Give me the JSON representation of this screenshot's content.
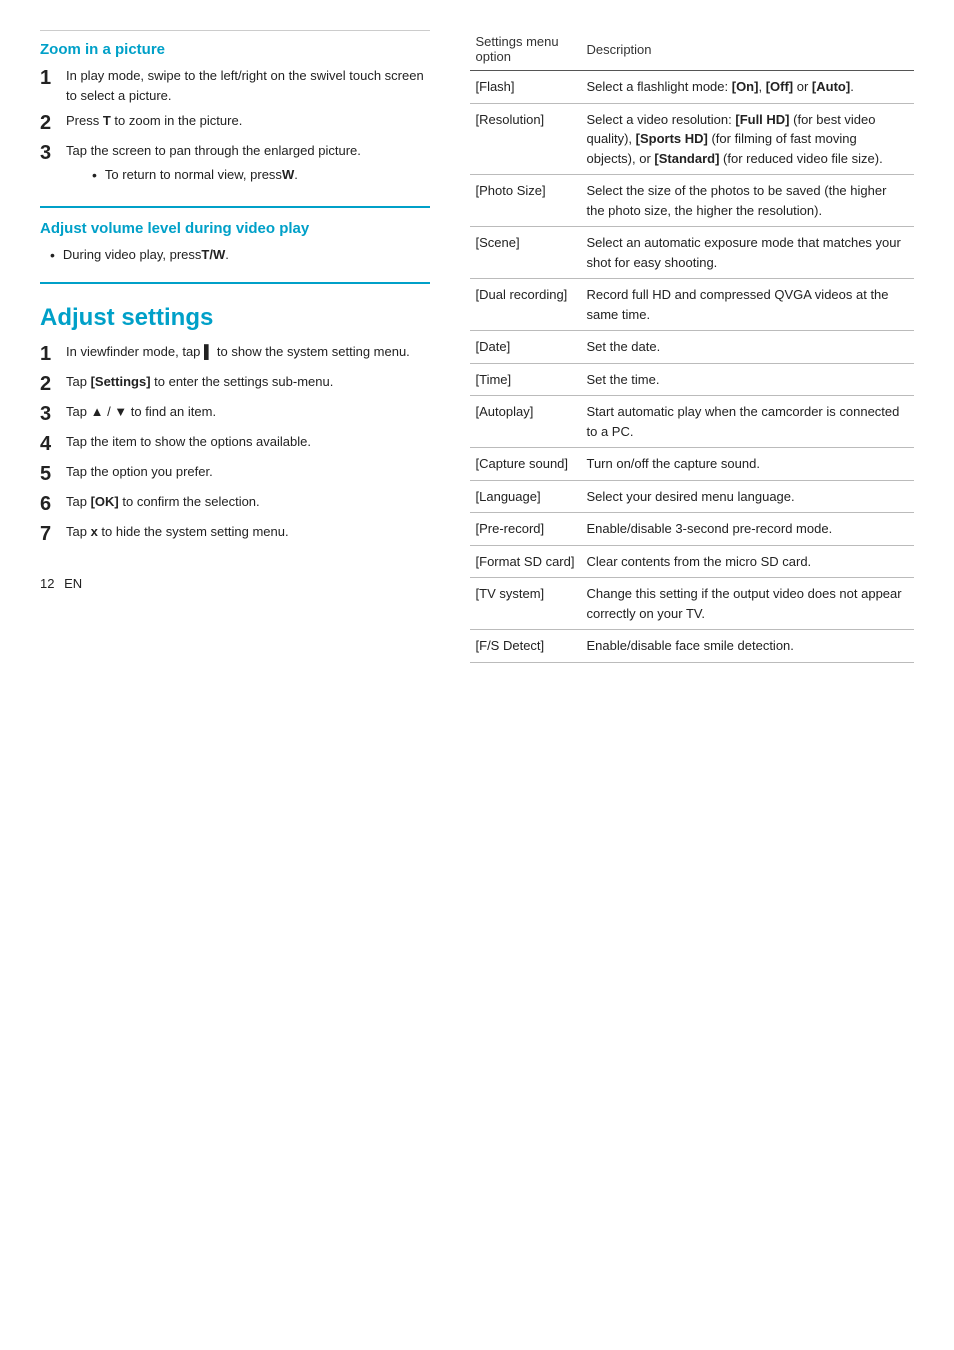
{
  "left": {
    "zoom_section": {
      "title": "Zoom in a picture",
      "steps": [
        {
          "num": "1",
          "text": "In play mode, swipe to the left/right on the swivel touch screen to select a picture."
        },
        {
          "num": "2",
          "text": "Press T to zoom in the picture.",
          "bold_chars": [
            "T"
          ]
        },
        {
          "num": "3",
          "text": "Tap the screen to pan through the enlarged picture.",
          "sub_bullet": "To return to normal view, press W.",
          "sub_bold": [
            "W"
          ]
        }
      ]
    },
    "volume_section": {
      "title": "Adjust volume level during video play",
      "bullet": "During video play, press T/W.",
      "bold_chars": [
        "T/W"
      ]
    },
    "adjust_section": {
      "title": "Adjust settings",
      "steps": [
        {
          "num": "1",
          "text": "In viewfinder mode, tap ▌ to show the system setting menu."
        },
        {
          "num": "2",
          "text": "Tap [Settings] to enter the settings sub-menu.",
          "bold": [
            "[Settings]"
          ]
        },
        {
          "num": "3",
          "text": "Tap ▲ / ▼ to find an item."
        },
        {
          "num": "4",
          "text": "Tap the item to show the options available."
        },
        {
          "num": "5",
          "text": "Tap the option you prefer."
        },
        {
          "num": "6",
          "text": "Tap [OK] to confirm the selection.",
          "bold": [
            "[OK]"
          ]
        },
        {
          "num": "7",
          "text": "Tap x to hide the system setting menu.",
          "bold": [
            "x"
          ]
        }
      ]
    }
  },
  "right": {
    "table_header": {
      "col1": "Settings menu option",
      "col2": "Description"
    },
    "rows": [
      {
        "option": "[Flash]",
        "description": "Select a flashlight mode: [On], [Off] or [Auto].",
        "desc_bold": [
          "[On]",
          "[Off]",
          "[Auto]"
        ]
      },
      {
        "option": "[Resolution]",
        "description": "Select a video resolution: [Full HD] (for best video quality), [Sports HD] (for filming of fast moving objects), or [Standard] (for reduced video file size).",
        "desc_bold": [
          "[Full HD]",
          "[Sports HD]",
          "[Standard]"
        ]
      },
      {
        "option": "[Photo Size]",
        "description": "Select the size of the photos to be saved (the higher the photo size, the higher the resolution)."
      },
      {
        "option": "[Scene]",
        "description": "Select an automatic exposure mode that matches your shot for easy shooting."
      },
      {
        "option": "[Dual recording]",
        "description": "Record full HD and compressed QVGA videos at the same time."
      },
      {
        "option": "[Date]",
        "description": "Set the date."
      },
      {
        "option": "[Time]",
        "description": "Set the time."
      },
      {
        "option": "[Autoplay]",
        "description": "Start automatic play when the camcorder is connected to a PC."
      },
      {
        "option": "[Capture sound]",
        "description": "Turn on/off the capture sound."
      },
      {
        "option": "[Language]",
        "description": "Select your desired menu language."
      },
      {
        "option": "[Pre-record]",
        "description": "Enable/disable 3-second pre-record mode."
      },
      {
        "option": "[Format SD card]",
        "description": "Clear contents from the micro SD card."
      },
      {
        "option": "[TV system]",
        "description": "Change this setting if the output video does not appear correctly on your TV."
      },
      {
        "option": "[F/S Detect]",
        "description": "Enable/disable face smile detection."
      }
    ]
  },
  "footer": {
    "page_num": "12",
    "lang": "EN"
  }
}
